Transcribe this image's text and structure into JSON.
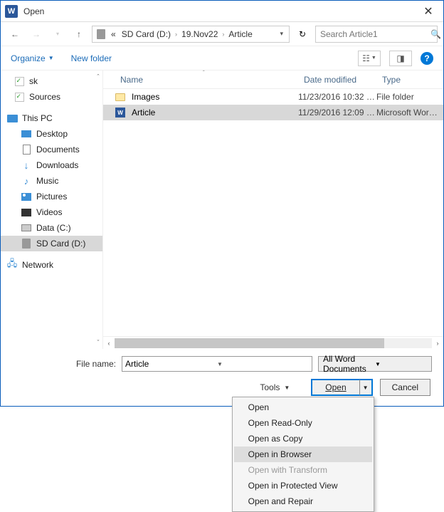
{
  "window": {
    "title": "Open"
  },
  "nav": {
    "crumb_prefix": "«",
    "crumbs": [
      "SD Card (D:)",
      "19.Nov22",
      "Article"
    ],
    "search_placeholder": "Search Article1"
  },
  "toolbar": {
    "organize": "Organize",
    "new_folder": "New folder"
  },
  "tree": {
    "items": [
      {
        "label": "sk",
        "icon": "fold-green"
      },
      {
        "label": "Sources",
        "icon": "fold-green"
      },
      {
        "label": "This PC",
        "icon": "thispc",
        "head": true
      },
      {
        "label": "Desktop",
        "icon": "desktop"
      },
      {
        "label": "Documents",
        "icon": "doc"
      },
      {
        "label": "Downloads",
        "icon": "down"
      },
      {
        "label": "Music",
        "icon": "music"
      },
      {
        "label": "Pictures",
        "icon": "pic"
      },
      {
        "label": "Videos",
        "icon": "vid"
      },
      {
        "label": "Data (C:)",
        "icon": "disk"
      },
      {
        "label": "SD Card (D:)",
        "icon": "sd",
        "selected": true
      },
      {
        "label": "Network",
        "icon": "net",
        "head": true
      }
    ]
  },
  "columns": {
    "name": "Name",
    "date": "Date modified",
    "type": "Type"
  },
  "files": [
    {
      "name": "Images",
      "icon": "folder",
      "date": "11/23/2016 10:32 …",
      "type": "File folder"
    },
    {
      "name": "Article",
      "icon": "word",
      "date": "11/29/2016 12:09 …",
      "type": "Microsoft Word D…",
      "selected": true
    }
  ],
  "footer": {
    "filename_label": "File name:",
    "filename_value": "Article",
    "filter": "All Word Documents",
    "tools": "Tools",
    "open": "Open",
    "cancel": "Cancel"
  },
  "menu": [
    {
      "label": "Open"
    },
    {
      "label": "Open Read-Only"
    },
    {
      "label": "Open as Copy"
    },
    {
      "label": "Open in Browser",
      "hover": true
    },
    {
      "label": "Open with Transform",
      "disabled": true
    },
    {
      "label": "Open in Protected View"
    },
    {
      "label": "Open and Repair"
    }
  ]
}
